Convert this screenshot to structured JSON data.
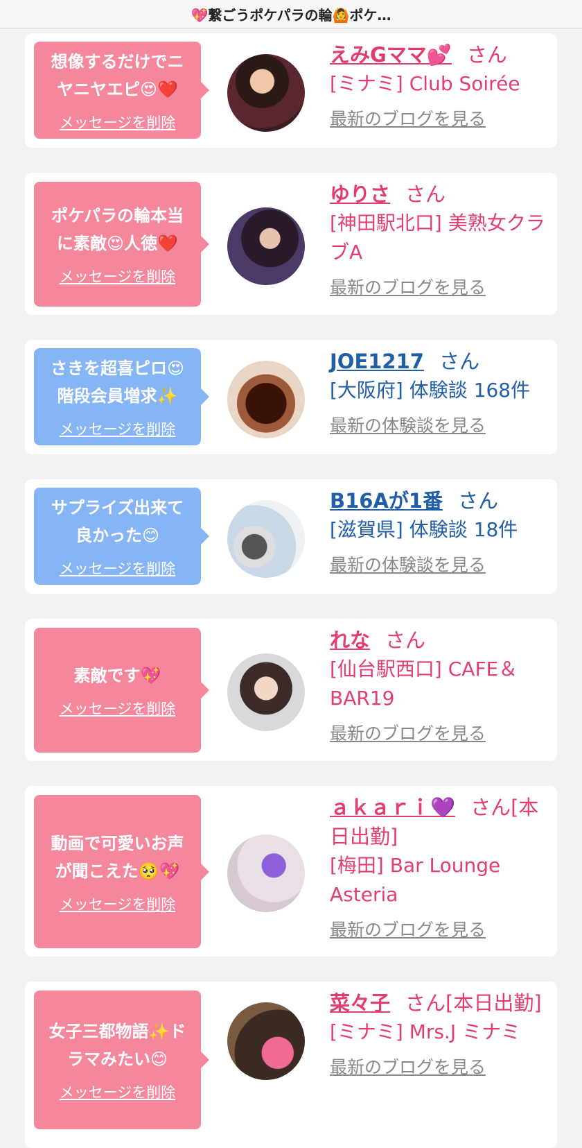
{
  "header": {
    "title": "💖繋ごうポケパラの輪🙆ポケ…"
  },
  "common": {
    "delete_label": "メッセージを削除",
    "san_label": "さん"
  },
  "cards": [
    {
      "message": "想像するだけでニ\nヤニヤエピ😍❤️",
      "name": "えみGママ💕",
      "san": "さん",
      "detail": "[ミナミ] Club Soirée",
      "link": "最新のブログを見る",
      "theme": "pink"
    },
    {
      "message": "ポケパラの輪本当\nに素敵😍人徳❤️",
      "name": "ゆりさ",
      "san": "さん",
      "detail": "[神田駅北口] 美熟女クラブA",
      "link": "最新のブログを見る",
      "theme": "pink"
    },
    {
      "message": "さきを超喜ピロ😍\n階段会員増求✨",
      "name": "JOE1217",
      "san": "さん",
      "detail": "[大阪府] 体験談 168件",
      "link": "最新の体験談を見る",
      "theme": "blue"
    },
    {
      "message": "サプライズ出来て\n良かった😊",
      "name": "B16Aが1番",
      "san": "さん",
      "detail": "[滋賀県] 体験談 18件",
      "link": "最新の体験談を見る",
      "theme": "blue"
    },
    {
      "message": "素敵です💖",
      "name": "れな",
      "san": "さん",
      "detail": "[仙台駅西口] CAFE＆BAR19",
      "link": "最新のブログを見る",
      "theme": "pink"
    },
    {
      "message": "動画で可愛いお声\nが聞こえた🥺💖",
      "name": "ａｋａｒｉ💜",
      "san": "さん[本日出勤]",
      "detail": "[梅田] Bar Lounge Asteria",
      "link": "最新のブログを見る",
      "theme": "pink"
    },
    {
      "message": "女子三都物語✨ド\nラマみたい😊",
      "name": "菜々子",
      "san": "さん[本日出勤]",
      "detail": "[ミナミ] Mrs.J ミナミ",
      "link": "最新のブログを見る",
      "theme": "pink"
    }
  ],
  "colors": {
    "pink_bubble": "#f5879d",
    "blue_bubble": "#86b5f5",
    "pink_text": "#e23d6e",
    "blue_text": "#215ea8"
  }
}
